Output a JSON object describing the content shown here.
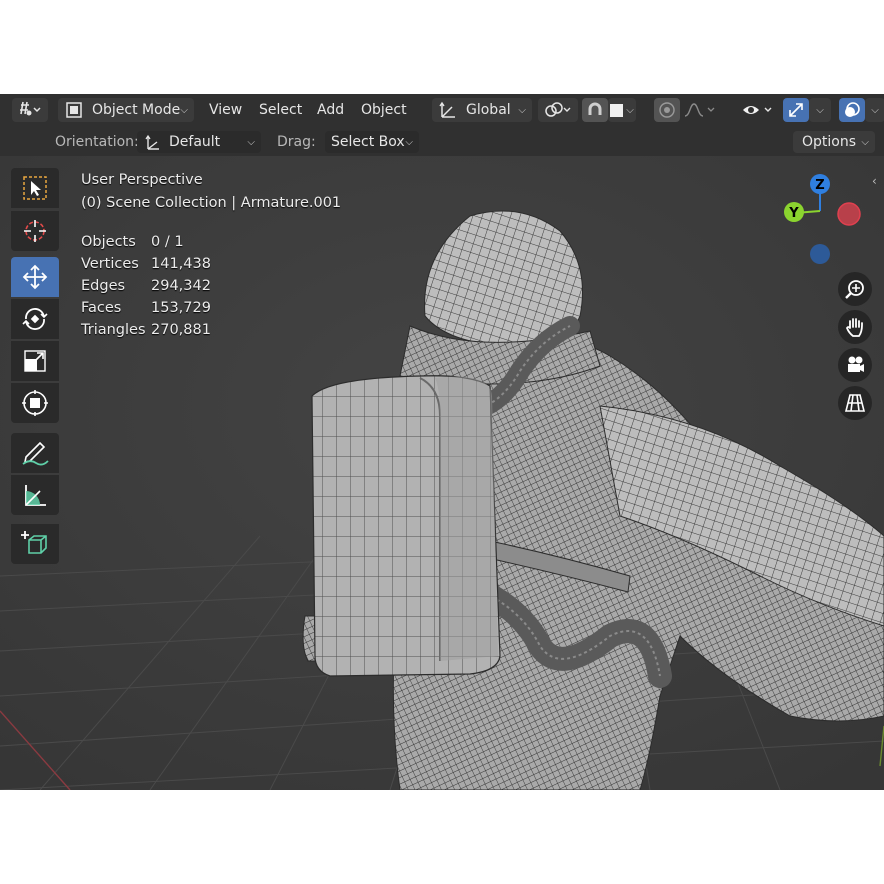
{
  "header": {
    "mode": "Object Mode",
    "menus": [
      "View",
      "Select",
      "Add",
      "Object"
    ],
    "transform_orientation": "Global"
  },
  "toolbar_header": {
    "orientation_label": "Orientation:",
    "orientation_value": "Default",
    "drag_label": "Drag:",
    "drag_value": "Select Box",
    "options_label": "Options"
  },
  "overlay": {
    "view_name": "User Perspective",
    "collection": "(0) Scene Collection | Armature.001"
  },
  "stats": [
    {
      "label": "Objects",
      "value": "0 / 1"
    },
    {
      "label": "Vertices",
      "value": "141,438"
    },
    {
      "label": "Edges",
      "value": "294,342"
    },
    {
      "label": "Faces",
      "value": "153,729"
    },
    {
      "label": "Triangles",
      "value": "270,881"
    }
  ],
  "gizmo": {
    "z": "Z",
    "y": "Y"
  },
  "colors": {
    "accent": "#4772b3",
    "axis_x": "#e0404f",
    "axis_y": "#8bd42f",
    "axis_z": "#2f7fe0",
    "viewport_bg": "#3d3d3d",
    "header_bg": "#303030"
  },
  "icons": {
    "tools": [
      "select-box-icon",
      "cursor-icon",
      "move-icon",
      "rotate-icon",
      "scale-icon",
      "transform-icon",
      "annotate-icon",
      "measure-icon",
      "add-cube-icon"
    ],
    "nav": [
      "zoom-icon",
      "hand-pan-icon",
      "camera-icon",
      "grid-perspective-icon"
    ]
  }
}
